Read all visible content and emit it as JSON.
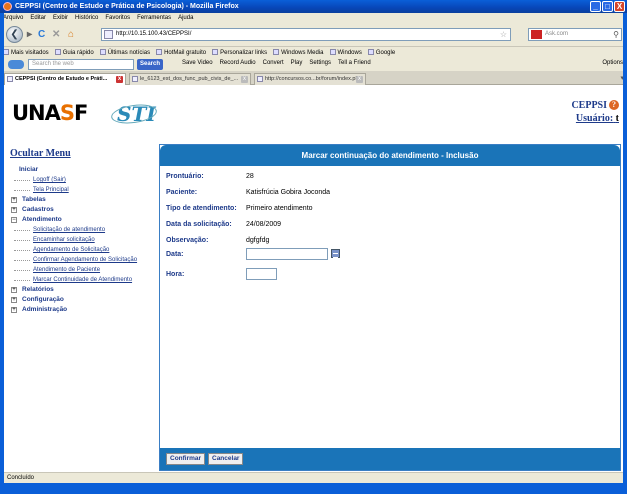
{
  "window": {
    "title": "CEPPSI (Centro de Estudo e Prática de Psicologia) - Mozilla Firefox",
    "minimize": "_",
    "maximize": "□",
    "close": "X"
  },
  "menubar": [
    "Arquivo",
    "Editar",
    "Exibir",
    "Histórico",
    "Favoritos",
    "Ferramentas",
    "Ajuda"
  ],
  "nav": {
    "back": "❮",
    "url": "http://10.15.100.43/CEPPSI/",
    "search_engine_value": "Ask.com"
  },
  "bookmarks": [
    "Mais visitados",
    "Guia rápido",
    "Últimas notícias",
    "HotMail gratuito",
    "Personalizar links",
    "Windows Media",
    "Windows",
    "Google"
  ],
  "search_toolbar": {
    "placeholder": "Search the web",
    "search_button": "Search",
    "items": [
      "Save Video",
      "Record Audio",
      "Convert",
      "Play",
      "Settings",
      "Tell a Friend"
    ],
    "options": "Options"
  },
  "tabs": [
    {
      "label": "CEPPSI (Centro de Estudo e Práti...",
      "active": true
    },
    {
      "label": "le_6123_est_dos_func_pub_civis_de_...",
      "active": false
    },
    {
      "label": "http://concursos.co...br/forum/index.php",
      "active": false
    }
  ],
  "header": {
    "logo_text_1": "UNA",
    "logo_text_2": "S",
    "logo_text_3": "F",
    "sti_logo": "STI",
    "system_name": "CEPPSI",
    "help_icon": "?",
    "user_label": "Usuário:",
    "user_value": "t"
  },
  "sidebar": {
    "toggle": "Ocultar Menu",
    "tree": [
      {
        "label": "Iniciar",
        "type": "section-open",
        "children": [
          "Logoff (Sair)",
          "Tela Principal"
        ]
      },
      {
        "label": "Tabelas",
        "type": "section-closed"
      },
      {
        "label": "Cadastros",
        "type": "section-closed"
      },
      {
        "label": "Atendimento",
        "type": "section-open",
        "children": [
          "Solicitação de atendimento",
          "Encaminhar solicitação",
          "Agendamento de Solicitação",
          "Confirmar Agendamento de Solicitação",
          "Atendimento de Paciente",
          "Marcar Continuidade de Atendimento"
        ]
      },
      {
        "label": "Relatórios",
        "type": "section-closed"
      },
      {
        "label": "Configuração",
        "type": "section-closed"
      },
      {
        "label": "Administração",
        "type": "section-closed"
      }
    ]
  },
  "form": {
    "title": "Marcar continuação do atendimento - Inclusão",
    "fields": [
      {
        "label": "Prontuário:",
        "value": "28"
      },
      {
        "label": "Paciente:",
        "value": "Katisfrúcia Gobira Joconda"
      },
      {
        "label": "Tipo de atendimento:",
        "value": "Primeiro atendimento"
      },
      {
        "label": "Data da solicitação:",
        "value": "24/08/2009"
      },
      {
        "label": "Observação:",
        "value": "dgfgfdg"
      }
    ],
    "data_label": "Data:",
    "data_value": "",
    "hora_label": "Hora:",
    "hora_value": "",
    "confirm_button": "Confirmar",
    "cancel_button": "Cancelar"
  },
  "status": "Concluído"
}
